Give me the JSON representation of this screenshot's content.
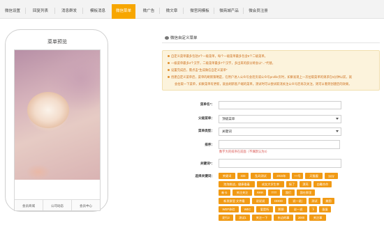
{
  "nav": {
    "tabs": [
      {
        "label": "微信设置",
        "active": false
      },
      {
        "label": "回复列表",
        "active": false
      },
      {
        "label": "消息群发",
        "active": false
      },
      {
        "label": "模板消息",
        "active": false
      },
      {
        "label": "微信菜单",
        "active": true
      },
      {
        "label": "微广告",
        "active": false
      },
      {
        "label": "微文章",
        "active": false
      },
      {
        "label": "微官网模板",
        "active": false
      },
      {
        "label": "微商城产品",
        "active": false
      },
      {
        "label": "微会员注册",
        "active": false
      }
    ]
  },
  "preview": {
    "title": "菜单预览",
    "menu_items": [
      "会员商城",
      "公司动态",
      "会员中心"
    ]
  },
  "pane": {
    "title": "微信自定义菜单",
    "notices": [
      "自定义菜单最多包括3个一级菜单，每个一级菜单最多包含5个二级菜单。",
      "一级菜单最多4个汉字，二级菜单最多7个汉字，多出来的部分将会以\"...\"代替。",
      "设置完成后，需点击\"生成微信自定义菜单\"",
      "创建自定义菜单后，菜单的刷新策略是，在用户进入公众号会话页或公众号profile页时，如果发现上一次拉取菜单的请求在5分钟以前，就",
      "会拉取一下菜单，如果菜单有更新，就会刷新客户端的菜单。测试时可以尝试取消关注公众号后再次关注，则可以看到创建后的效果。"
    ]
  },
  "form": {
    "menu_name": {
      "label": "菜单名*：",
      "value": ""
    },
    "parent_menu": {
      "label": "父级菜单：",
      "value": "顶级菜单"
    },
    "menu_type": {
      "label": "菜单类型：",
      "value": "关键词"
    },
    "sort": {
      "label": "排序：",
      "value": "",
      "hint": "数字大的排序在前面（不填默认为0）"
    },
    "keyword": {
      "label": "关键词*：",
      "value": ""
    },
    "keyword_select_label": "选择关键词："
  },
  "keywords": [
    [
      "关键词",
      "333",
      "乱码测试",
      "2015年",
      "++号",
      "天猫盟",
      "yyyy"
    ],
    [
      "泡泡挑战，健康看着",
      "成女大学生幸",
      "摇了",
      "漂亮",
      "白雕合作"
    ],
    [
      "新卡",
      "关注关注",
      "RRR",
      "TTT",
      "我们",
      "我在那里"
    ],
    [
      "新发群里 文件看",
      "说说说",
      "DDDD",
      "说一说|",
      "测试",
      "美图"
    ],
    [
      "WEP体验",
      "WEC",
      "爱是所",
      "鹅鹅",
      "说一说",
      "下",
      "蛋蛋"
    ],
    [
      "发行2",
      "测试1",
      "关注一下",
      "东边的事",
      "2000",
      "关注事"
    ]
  ],
  "colors": {
    "accent": "#f7a600",
    "keyword_bg": "#f19a14",
    "notice_bg": "#fcf3dc",
    "notice_text": "#cc6d1a",
    "hint_text": "#d9534f"
  }
}
